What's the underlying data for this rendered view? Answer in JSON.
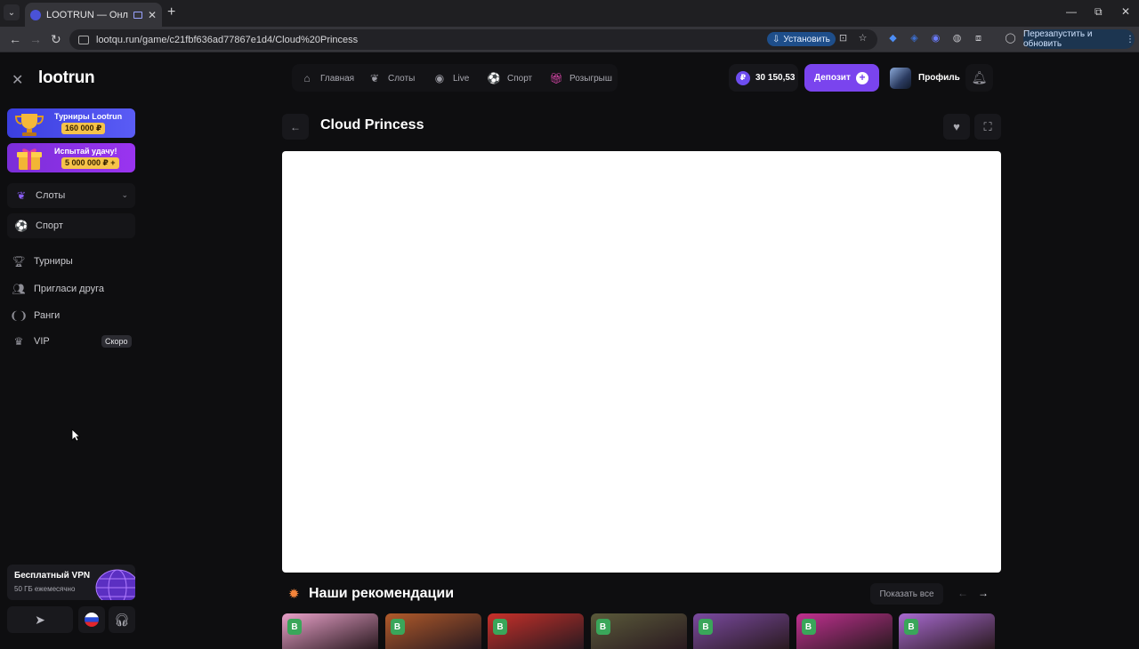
{
  "browser": {
    "tab_title": "LOOTRUN — Онлайн Каз...",
    "url": "lootqu.run/game/c21fbf636ad77867e1d4/Cloud%20Princess",
    "install_label": "Установить",
    "restart_label": "Перезапустить и обновить"
  },
  "site": {
    "logo": "lootrun",
    "promos": [
      {
        "title": "Турниры Lootrun",
        "amount": "160 000 ₽"
      },
      {
        "title": "Испытай удачу!",
        "amount": "5 000 000 ₽ +"
      }
    ],
    "sidebar": {
      "slots": "Слоты",
      "sport": "Спорт",
      "tournaments": "Турниры",
      "invite": "Пригласи друга",
      "ranks": "Ранги",
      "vip": "VIP",
      "soon": "Скоро"
    },
    "vpn": {
      "title": "Бесплатный VPN",
      "subtitle": "50 ГБ ежемесячно"
    },
    "topnav": {
      "home": "Главная",
      "slots": "Слоты",
      "live": "Live",
      "sport": "Спорт",
      "draw": "Розыгрыш"
    },
    "balance": "30 150,53",
    "deposit": "Депозит",
    "profile": "Профиль"
  },
  "game": {
    "title": "Cloud Princess"
  },
  "recommendations": {
    "title": "Наши рекомендации",
    "show_all": "Показать все",
    "badge": "B",
    "card_colors": [
      "#e8a0c8",
      "#b05a2a",
      "#c8302a",
      "#5a5a3a",
      "#7a4aa0",
      "#c03090",
      "#a86ad0"
    ]
  }
}
